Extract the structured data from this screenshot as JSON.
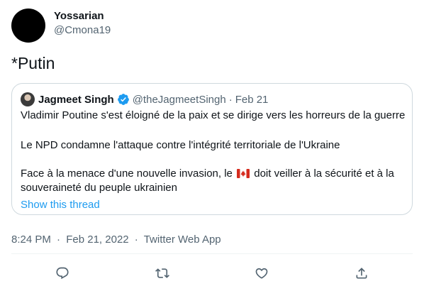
{
  "author": {
    "name": "Yossarian",
    "handle": "@Cmona19"
  },
  "tweet": {
    "text": "*Putin"
  },
  "quoted": {
    "name": "Jagmeet Singh",
    "handle": "@theJagmeetSingh",
    "separator": "·",
    "date": "Feb 21",
    "line1": "Vladimir Poutine s'est éloigné de la paix et se dirige vers les horreurs de la guerre",
    "line2": "Le NPD condamne l'attaque contre l'intégrité territoriale de l'Ukraine",
    "line3_before_flag": "Face à la menace d'une nouvelle invasion, le",
    "line3_after_flag": "doit veiller à la sécurité et à la",
    "line4": "souveraineté du peuple ukrainien",
    "show_thread": "Show this thread"
  },
  "meta": {
    "time": "8:24 PM",
    "separator": "·",
    "date": "Feb 21, 2022",
    "source": "Twitter Web App"
  },
  "actions": [
    "reply-icon",
    "retweet-icon",
    "like-icon",
    "share-icon"
  ],
  "colors": {
    "text": "#0f1419",
    "secondary": "#536471",
    "link": "#1d9bf0",
    "border": "#cfd9de",
    "verified": "#1d9bf0"
  }
}
